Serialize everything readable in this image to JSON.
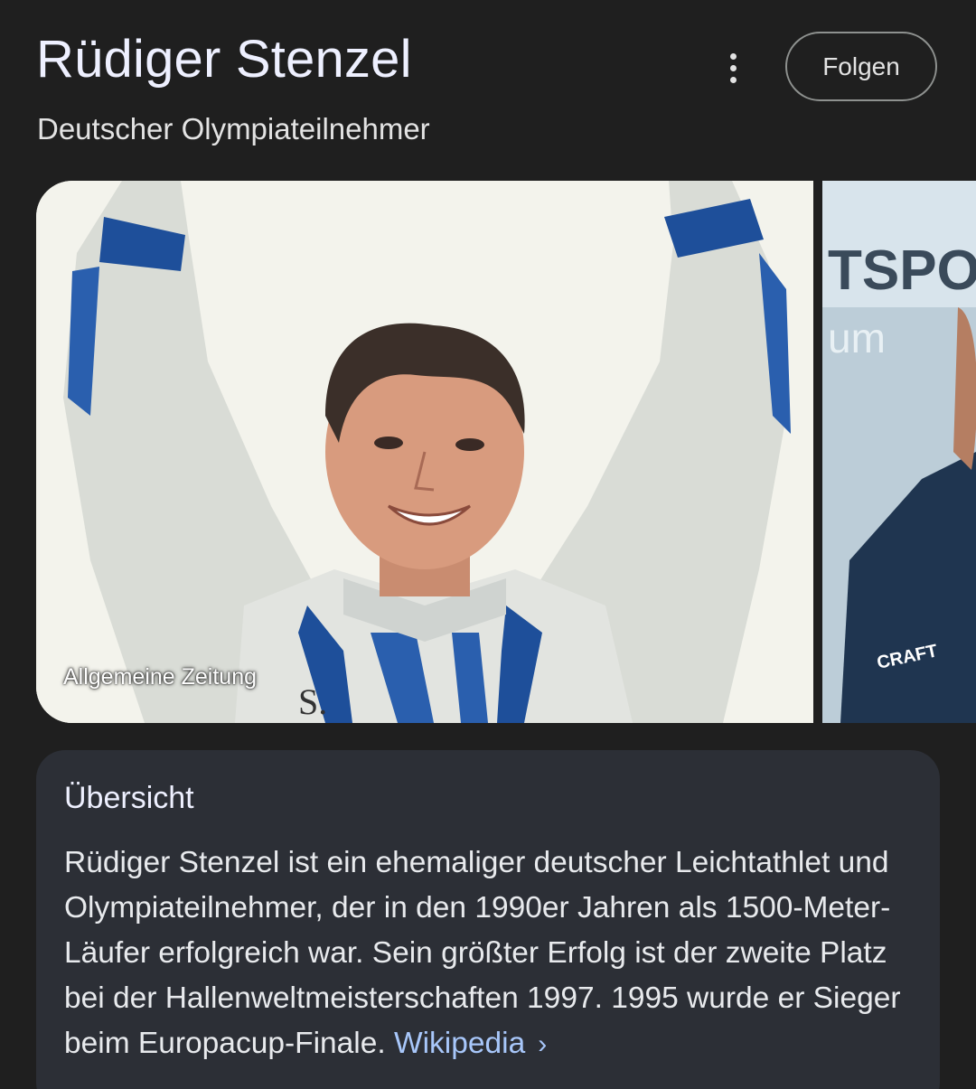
{
  "header": {
    "title": "Rüdiger Stenzel",
    "subtitle": "Deutscher Olympiateilnehmer",
    "follow_label": "Folgen"
  },
  "images": {
    "main_credit": "Allgemeine Zeitung",
    "second_banner_text": "TSPO",
    "second_banner_sub": "um",
    "second_logo": "CRAFT"
  },
  "overview": {
    "heading": "Übersicht",
    "text": "Rüdiger Stenzel ist ein ehemaliger deutscher Leichtathlet und Olympiateilnehmer, der in den 1990er Jahren als 1500-Meter-Läufer erfolgreich war. Sein größter Erfolg ist der zweite Platz bei der Hallenweltmeisterschaften 1997. 1995 wurde er Sieger beim Europacup-Finale.",
    "link_label": "Wikipedia",
    "link_chevron": "›"
  },
  "colors": {
    "background": "#1f1f1f",
    "card": "#2c2f36",
    "link": "#a8c7fa"
  }
}
